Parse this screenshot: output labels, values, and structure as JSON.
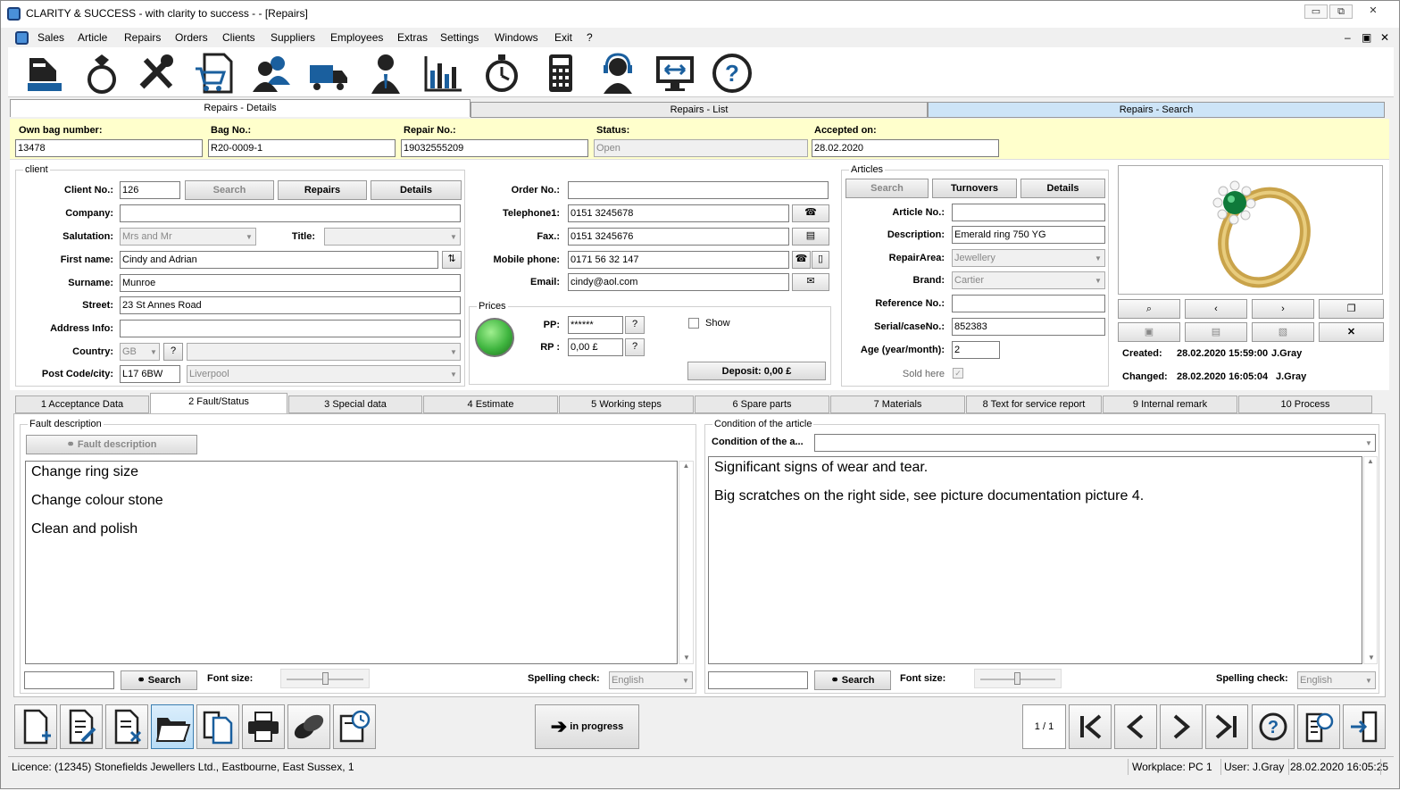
{
  "window": {
    "title": "CLARITY & SUCCESS   - with clarity to success - - [Repairs]",
    "min": "▭",
    "max": "⧉",
    "close": "✕",
    "mdi_min": "–",
    "mdi_max": "▣",
    "mdi_close": "✕"
  },
  "menu": [
    "Sales",
    "Article",
    "Repairs",
    "Orders",
    "Clients",
    "Suppliers",
    "Employees",
    "Extras",
    "Settings",
    "Windows",
    "Exit",
    "?"
  ],
  "toolbar_icons": [
    "sales-icon",
    "ring-icon",
    "tools-icon",
    "cart-document-icon",
    "clients-icon",
    "truck-icon",
    "employee-icon",
    "statistics-icon",
    "stopwatch-icon",
    "calculator-icon",
    "support-headset-icon",
    "remote-screen-icon",
    "help-icon"
  ],
  "main_tabs": [
    "Repairs - Details",
    "Repairs - List",
    "Repairs - Search"
  ],
  "header": {
    "own_bag_label": "Own bag number:",
    "own_bag": "13478",
    "bag_no_label": "Bag No.:",
    "bag_no": "R20-0009-1",
    "repair_no_label": "Repair No.:",
    "repair_no": "19032555209",
    "status_label": "Status:",
    "status": "Open",
    "accepted_label": "Accepted on:",
    "accepted": "28.02.2020"
  },
  "client": {
    "group": "client",
    "client_no_label": "Client No.:",
    "client_no": "126",
    "search": "Search",
    "repairs": "Repairs",
    "details": "Details",
    "company_label": "Company:",
    "company": "",
    "salutation_label": "Salutation:",
    "salutation": "Mrs and Mr",
    "title_label": "Title:",
    "title": "",
    "first_name_label": "First name:",
    "first_name": "Cindy and Adrian",
    "surname_label": "Surname:",
    "surname": "Munroe",
    "street_label": "Street:",
    "street": "23 St Annes Road",
    "address_info_label": "Address Info:",
    "address_info": "",
    "country_label": "Country:",
    "country": "GB",
    "country_help": "?",
    "postcode_label": "Post Code/city:",
    "postcode": "L17 6BW",
    "city": "Liverpool",
    "order_no_label": "Order No.:",
    "order_no": "",
    "telephone_label": "Telephone1:",
    "telephone": "0151 3245678",
    "fax_label": "Fax.:",
    "fax": "0151 3245676",
    "mobile_label": "Mobile phone:",
    "mobile": "0171 56 32 147",
    "email_label": "Email:",
    "email": "cindy@aol.com"
  },
  "prices": {
    "group": "Prices",
    "pp_label": "PP:",
    "pp": "******",
    "rp_label": "RP :",
    "rp": "0,00 £",
    "help": "?",
    "show": "Show",
    "deposit": "Deposit: 0,00 £"
  },
  "articles": {
    "group": "Articles",
    "search": "Search",
    "turnovers": "Turnovers",
    "details": "Details",
    "article_no_label": "Article No.:",
    "article_no": "",
    "description_label": "Description:",
    "description": "Emerald ring 750 YG",
    "repair_area_label": "RepairArea:",
    "repair_area": "Jewellery",
    "brand_label": "Brand:",
    "brand": "Cartier",
    "reference_label": "Reference No.:",
    "reference": "",
    "serial_label": "Serial/caseNo.:",
    "serial": "852383",
    "age_label": "Age (year/month):",
    "age": "2",
    "sold_here_label": "Sold here"
  },
  "image_info": {
    "created_label": "Created:",
    "created": "28.02.2020 15:59:00",
    "created_by": "J.Gray",
    "changed_label": "Changed:",
    "changed": "28.02.2020 16:05:04",
    "changed_by": "J.Gray"
  },
  "sub_tabs": [
    "1 Acceptance Data",
    "2 Fault/Status",
    "3 Special data",
    "4 Estimate",
    "5 Working steps",
    "6 Spare parts",
    "7 Materials",
    "8 Text for service report",
    "9 Internal remark",
    "10 Process"
  ],
  "fault": {
    "group": "Fault description",
    "button": "Fault description",
    "lines": [
      "Change ring size",
      "Change colour stone",
      "Clean and polish"
    ],
    "search": "Search",
    "font_size_label": "Font size:",
    "spelling_label": "Spelling check:",
    "spelling": "English"
  },
  "condition": {
    "group": "Condition of the article",
    "label": "Condition of the a...",
    "lines": [
      "Significant signs of wear and tear.",
      "Big scratches on the right side, see picture documentation picture 4."
    ],
    "search": "Search",
    "font_size_label": "Font size:",
    "spelling_label": "Spelling check:",
    "spelling": "English"
  },
  "bottom": {
    "in_progress": "in progress",
    "page": "1 / 1"
  },
  "statusbar": {
    "licence": "Licence: (12345) Stonefields Jewellers Ltd., Eastbourne, East Sussex, 1",
    "workplace_label": "Workplace:",
    "workplace": "PC 1",
    "user": "User: J.Gray",
    "datetime": "28.02.2020 16:05:25"
  },
  "colors": {
    "accent": "#1a5f9e",
    "yellow": "#ffffcc",
    "active_tab": "#cde4f7",
    "led": "#3fb53f"
  }
}
